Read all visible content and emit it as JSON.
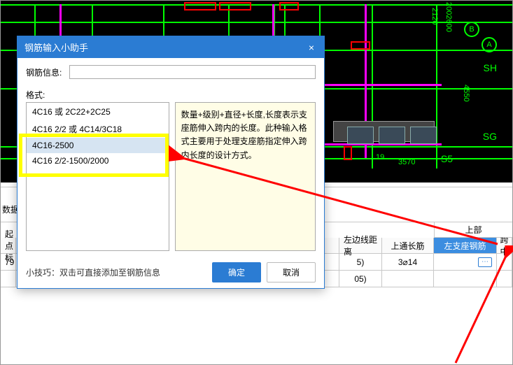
{
  "dialog": {
    "title": "钢筋输入小助手",
    "close": "×",
    "info_label": "钢筋信息:",
    "info_value": "",
    "format_label": "格式:",
    "items": [
      "4C16 或 2C22+2C25",
      "4C16 2/2 或 4C14/3C18",
      "4C16-2500",
      "4C16 2/2-1500/2000"
    ],
    "selected_index": 2,
    "description": "数量+级别+直径+长度,长度表示支座筋伸入跨内的长度。此种输入格式主要用于处理支座筋指定伸入跨内长度的设计方式。",
    "tip": "小技巧：双击可直接添加至钢筋信息",
    "ok": "确定",
    "cancel": "取消"
  },
  "cad": {
    "axis_labels": [
      "B",
      "A",
      "SH",
      "SG",
      "S5"
    ],
    "dims": {
      "d1": "2120",
      "d2": "2002600",
      "d3": "4550",
      "d4": "19",
      "d5": "3570"
    }
  },
  "data_panel": {
    "section_label": "数据",
    "headers": {
      "qidian": "起点标",
      "edge_dist": "左边线距离",
      "top_long": "上通长筋",
      "top_group": "上部",
      "left_seat": "左支座钢筋",
      "kuazhong": "跨中"
    },
    "row": {
      "qidian": "79",
      "edge5": "5)",
      "edge05": "05)",
      "top_long": "3⌀14",
      "left_seat": "",
      "more": "⋯"
    }
  }
}
